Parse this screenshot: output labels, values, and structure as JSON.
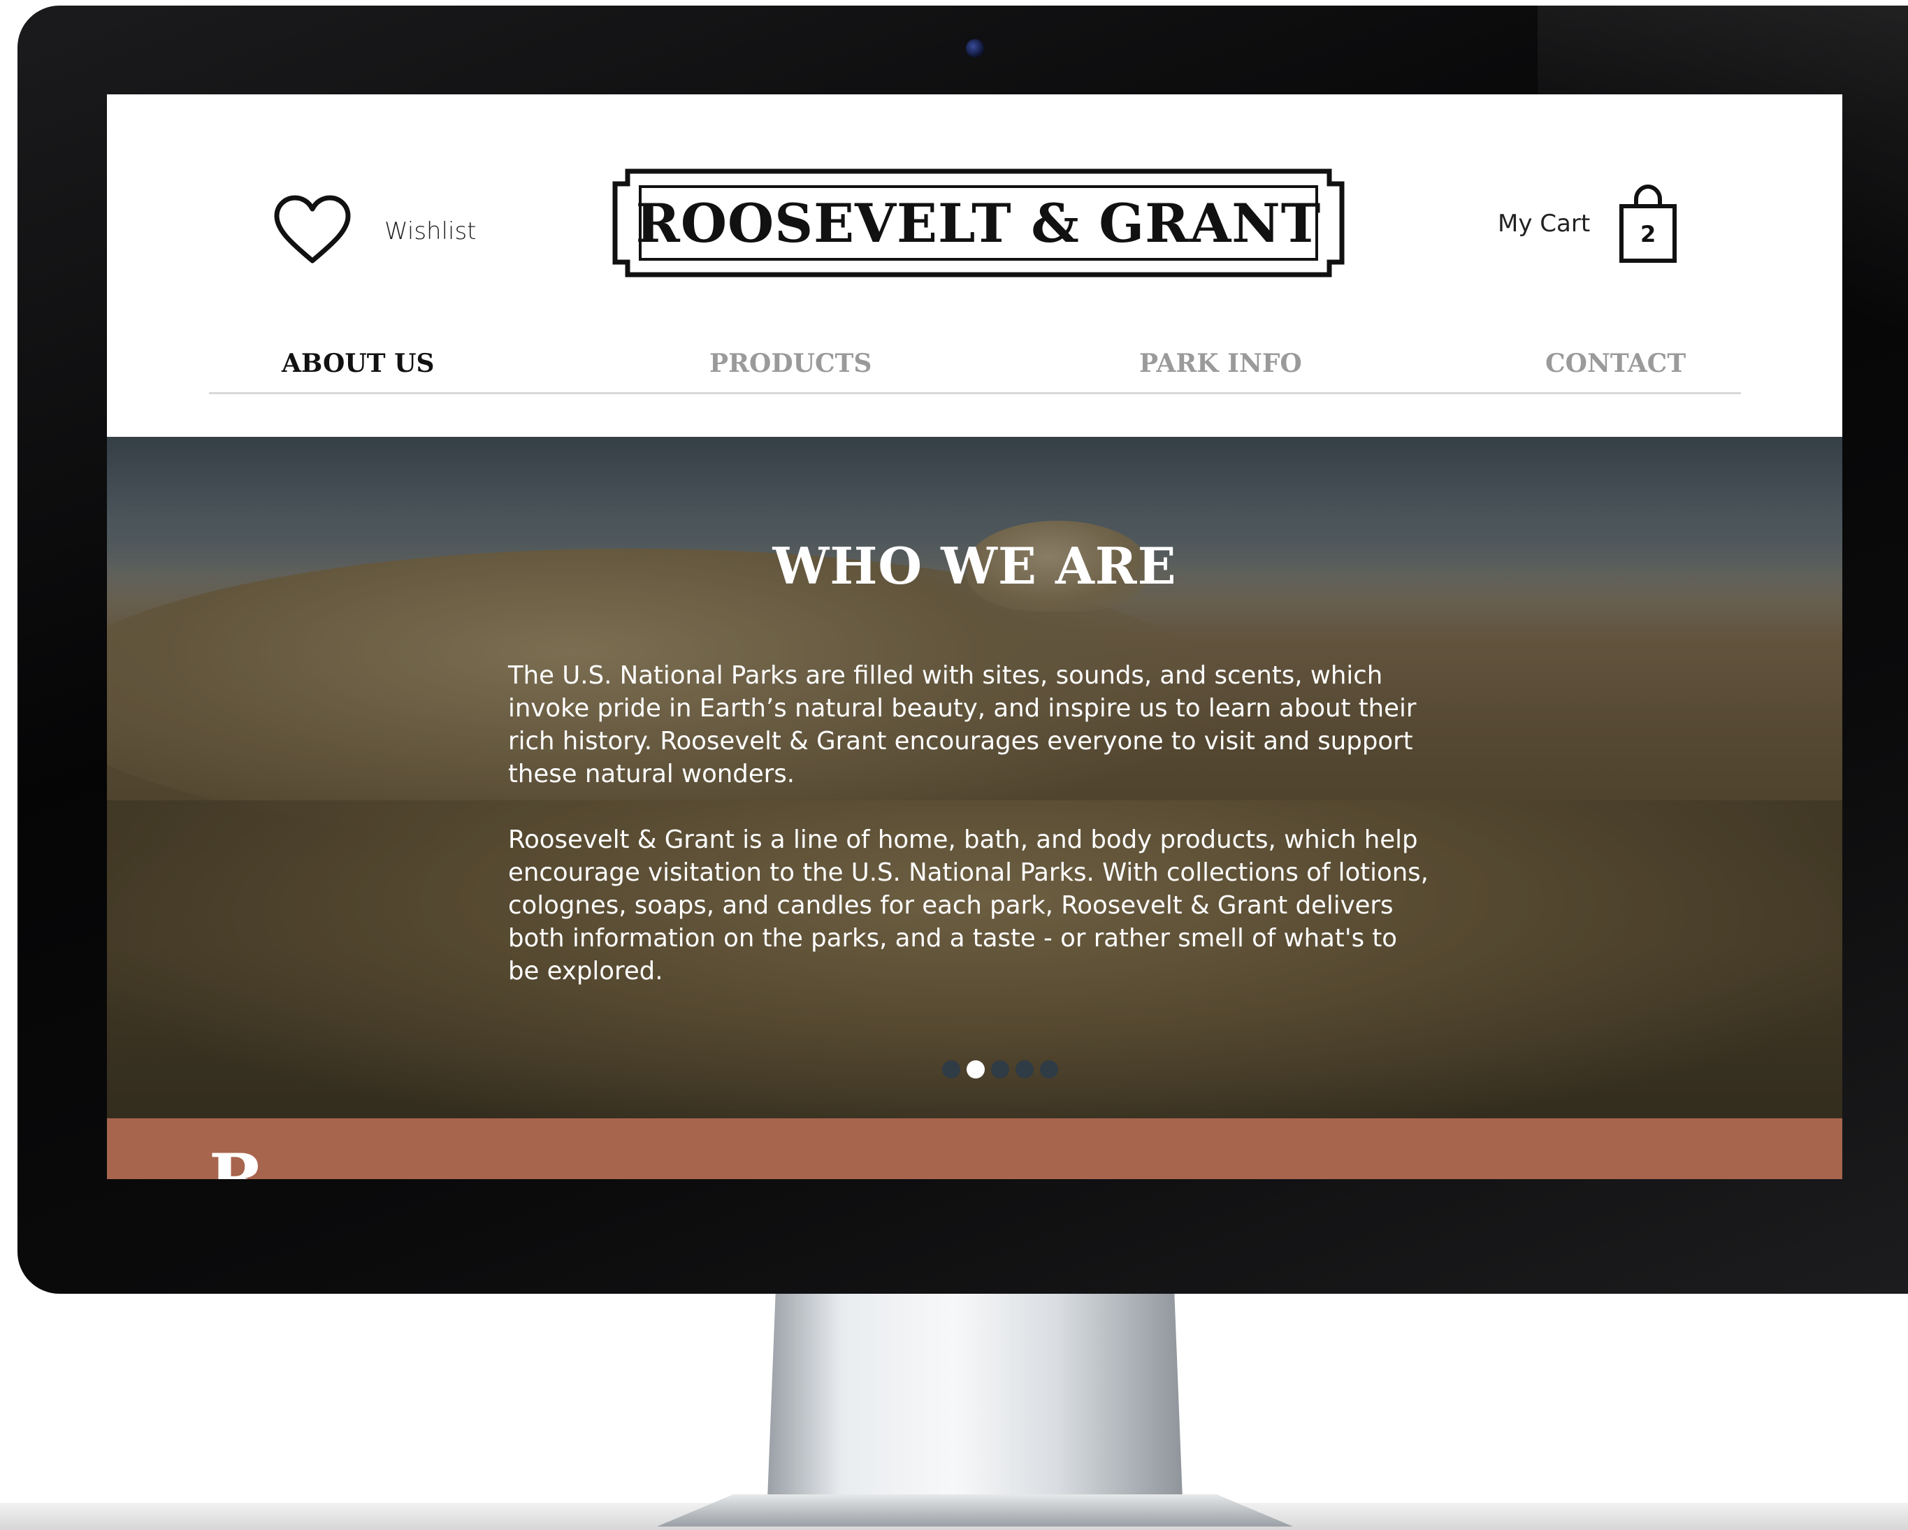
{
  "header": {
    "wishlist_label": "Wishlist",
    "logo_text": "ROOSEVELT & GRANT",
    "cart_label": "My Cart",
    "cart_count": "2"
  },
  "nav": {
    "items": [
      {
        "label": "ABOUT US",
        "active": true
      },
      {
        "label": "PRODUCTS",
        "active": false
      },
      {
        "label": "PARK INFO",
        "active": false
      },
      {
        "label": "CONTACT",
        "active": false
      }
    ]
  },
  "hero": {
    "title": "WHO WE ARE",
    "paragraphs": [
      "The U.S. National Parks are filled with sites, sounds, and scents, which invoke pride in Earth’s natural beauty, and inspire us to learn about their rich history. Roosevelt & Grant encourages everyone to visit and support these natural wonders.",
      "Roosevelt & Grant is a line of home, bath, and body products, which help encourage visitation to the U.S. National Parks. With collections of lotions, colognes, soaps, and candles for each park, Roosevelt & Grant delivers both information on the parks, and a taste - or rather smell of what's to be explored."
    ],
    "carousel": {
      "total": 5,
      "active_index": 1
    }
  },
  "next_section": {
    "partial_heading": "R"
  },
  "colors": {
    "accent_strip": "#a8654e",
    "nav_active": "#111111",
    "nav_inactive": "#9a9a9a"
  },
  "icons": {
    "wishlist": "heart-icon",
    "cart": "shopping-bag-icon",
    "camera": "camera-icon"
  }
}
